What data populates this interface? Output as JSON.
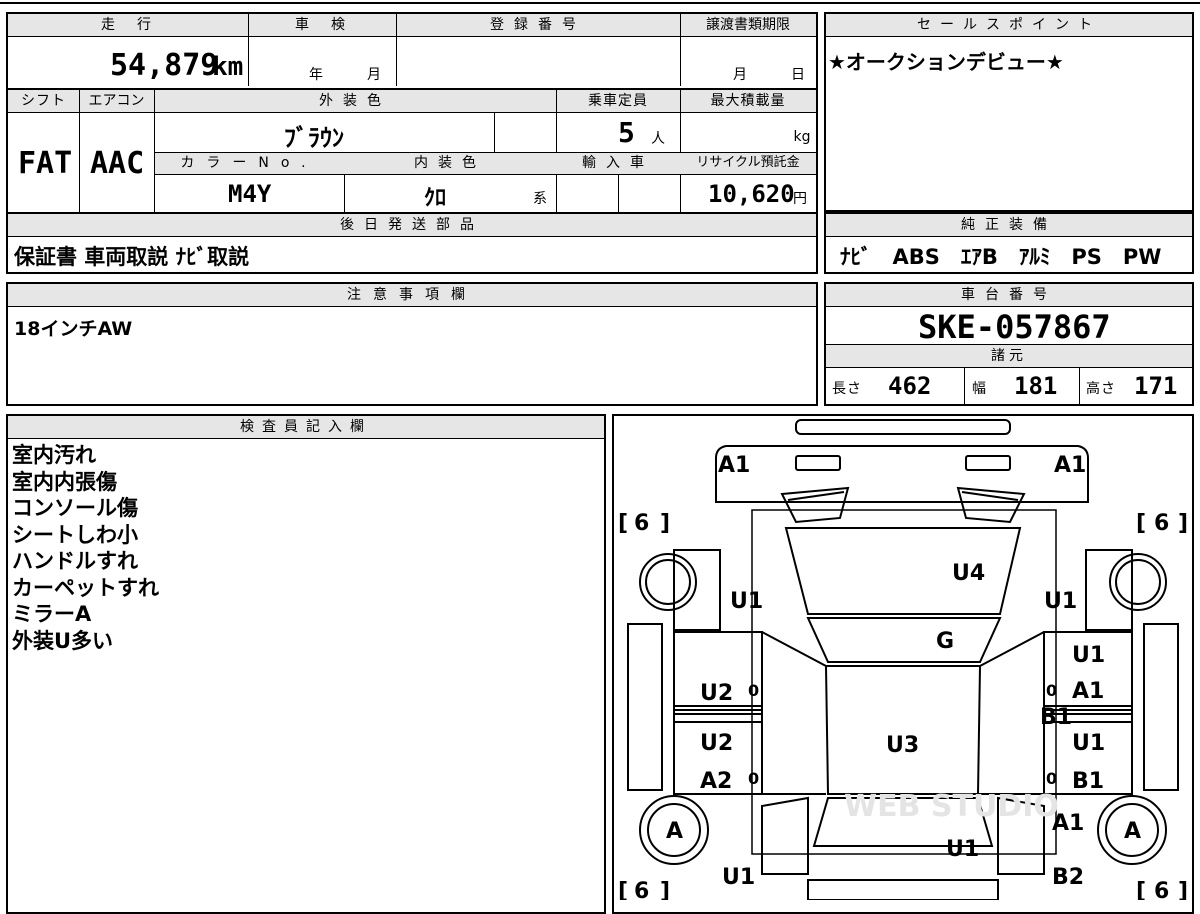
{
  "top": {
    "mileage_label": "走　行",
    "mileage": "54,879",
    "mileage_unit": "km",
    "inspection_label": "車　検",
    "inspection_year": "年",
    "inspection_month": "月",
    "reg_label": "登録番号",
    "transfer_label": "譲渡書類期限",
    "transfer_month": "月",
    "transfer_day": "日",
    "shift_label": "シフト",
    "ac_label": "エアコン",
    "exterior_label": "外装色",
    "capacity_label": "乗車定員",
    "load_label": "最大積載量",
    "shift": "FAT",
    "ac": "AAC",
    "exterior_color": "ﾌﾞﾗｳﾝ",
    "capacity": "5",
    "capacity_unit": "人",
    "load_unit": "kg",
    "color_no_label": "カラーNo.",
    "interior_label": "内装色",
    "import_label": "輸入車",
    "recycle_label": "リサイクル預託金",
    "color_no": "M4Y",
    "interior_color": "ｸﾛ",
    "interior_suffix": "系",
    "recycle_fee": "10,620",
    "recycle_unit": "円",
    "later_label": "後日発送部品",
    "later_items": "保証書 車両取説 ﾅﾋﾞ取説"
  },
  "sales": {
    "label": "セールスポイント",
    "text": "★オークションデビュー★"
  },
  "equipment": {
    "label": "純正装備",
    "items": "ﾅﾋﾞ　ABS　ｴｱB　ｱﾙﾐ　PS　PW"
  },
  "caution": {
    "label": "注意事項欄",
    "text": "18インチAW"
  },
  "chassis": {
    "label": "車台番号",
    "number": "SKE-057867",
    "spec_label": "諸元",
    "length_label": "長さ",
    "length": "462",
    "width_label": "幅",
    "width": "181",
    "height_label": "高さ",
    "height": "171"
  },
  "inspector": {
    "label": "検査員記入欄",
    "notes": [
      "室内汚れ",
      "室内内張傷",
      "コンソール傷",
      "シートしわ小",
      "ハンドルすれ",
      "カーペットすれ",
      "ミラーA",
      "外装U多い"
    ]
  },
  "diagram": {
    "marks": {
      "front_left": "A1",
      "front_right": "A1",
      "tire_tl": "6",
      "tire_tr": "6",
      "tire_bl": "6",
      "tire_br": "6",
      "hood": "U4",
      "fender_l": "U1",
      "fender_r": "U1",
      "windshield": "G",
      "door_fl": "U2",
      "door_fl_tag": "0",
      "door_rl": "U2",
      "door_rl2": "A2",
      "door_rl_tag": "0",
      "door_fr": "U1",
      "door_fr2": "A1",
      "door_fr_tag": "0",
      "door_fr3": "B1",
      "door_rr": "U1",
      "door_rr2": "B1",
      "door_rr_tag": "0",
      "roof": "U3",
      "wheel_bl": "A",
      "wheel_br": "A",
      "quarter_r": "A1",
      "rear": "U1",
      "rear_l": "U1",
      "rear_r": "B2"
    },
    "watermark": "WEB STUDIO"
  }
}
